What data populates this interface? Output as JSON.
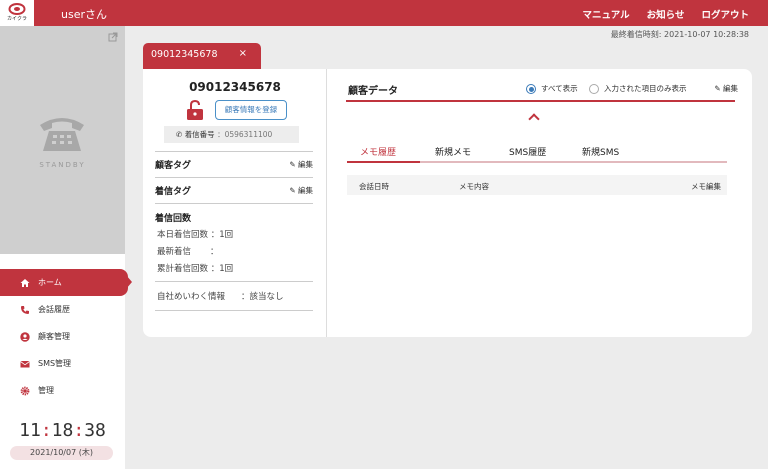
{
  "header": {
    "logo_text": "カイクラ",
    "user": "userさん",
    "nav": [
      "マニュアル",
      "お知らせ",
      "ログアウト"
    ],
    "last_call": "最終着信時刻: 2021-10-07 10:28:38"
  },
  "sidebar": {
    "standby": "STANDBY",
    "items": [
      {
        "label": "ホーム",
        "icon": "home-icon",
        "active": true
      },
      {
        "label": "会話履歴",
        "icon": "phone-icon"
      },
      {
        "label": "顧客管理",
        "icon": "user-icon"
      },
      {
        "label": "SMS管理",
        "icon": "mail-icon"
      },
      {
        "label": "管理",
        "icon": "gear-icon"
      }
    ],
    "clock": {
      "h": "11",
      "m": "18",
      "s": "38",
      "sep": ":"
    },
    "date": "2021/10/07 (木)"
  },
  "tab": {
    "label": "09012345678",
    "close": "×"
  },
  "caller": {
    "number": "09012345678",
    "register_button": "顧客情報を登録",
    "incoming_label": "着信番号",
    "incoming_number": "：0596311100",
    "customer_tag": "顧客タグ",
    "incoming_tag": "着信タグ",
    "edit": "編集",
    "call_count_title": "着信回数",
    "today_count_label": "本日着信回数",
    "today_count_value": "：1回",
    "latest_label": "最新着信",
    "latest_value": "：",
    "total_label": "累計着信回数",
    "total_value": "：1回",
    "nuisance_label": "自社めいわく情報",
    "nuisance_value": "：該当なし"
  },
  "customer": {
    "title": "顧客データ",
    "radio_all": "すべて表示",
    "radio_entered": "入力された項目のみ表示",
    "edit": "編集",
    "tabs": [
      "メモ履歴",
      "新規メモ",
      "SMS履歴",
      "新規SMS"
    ],
    "columns": [
      "会話日時",
      "メモ内容",
      "メモ編集"
    ]
  },
  "colors": {
    "accent": "#c0343e",
    "link": "#3a7ab8"
  }
}
